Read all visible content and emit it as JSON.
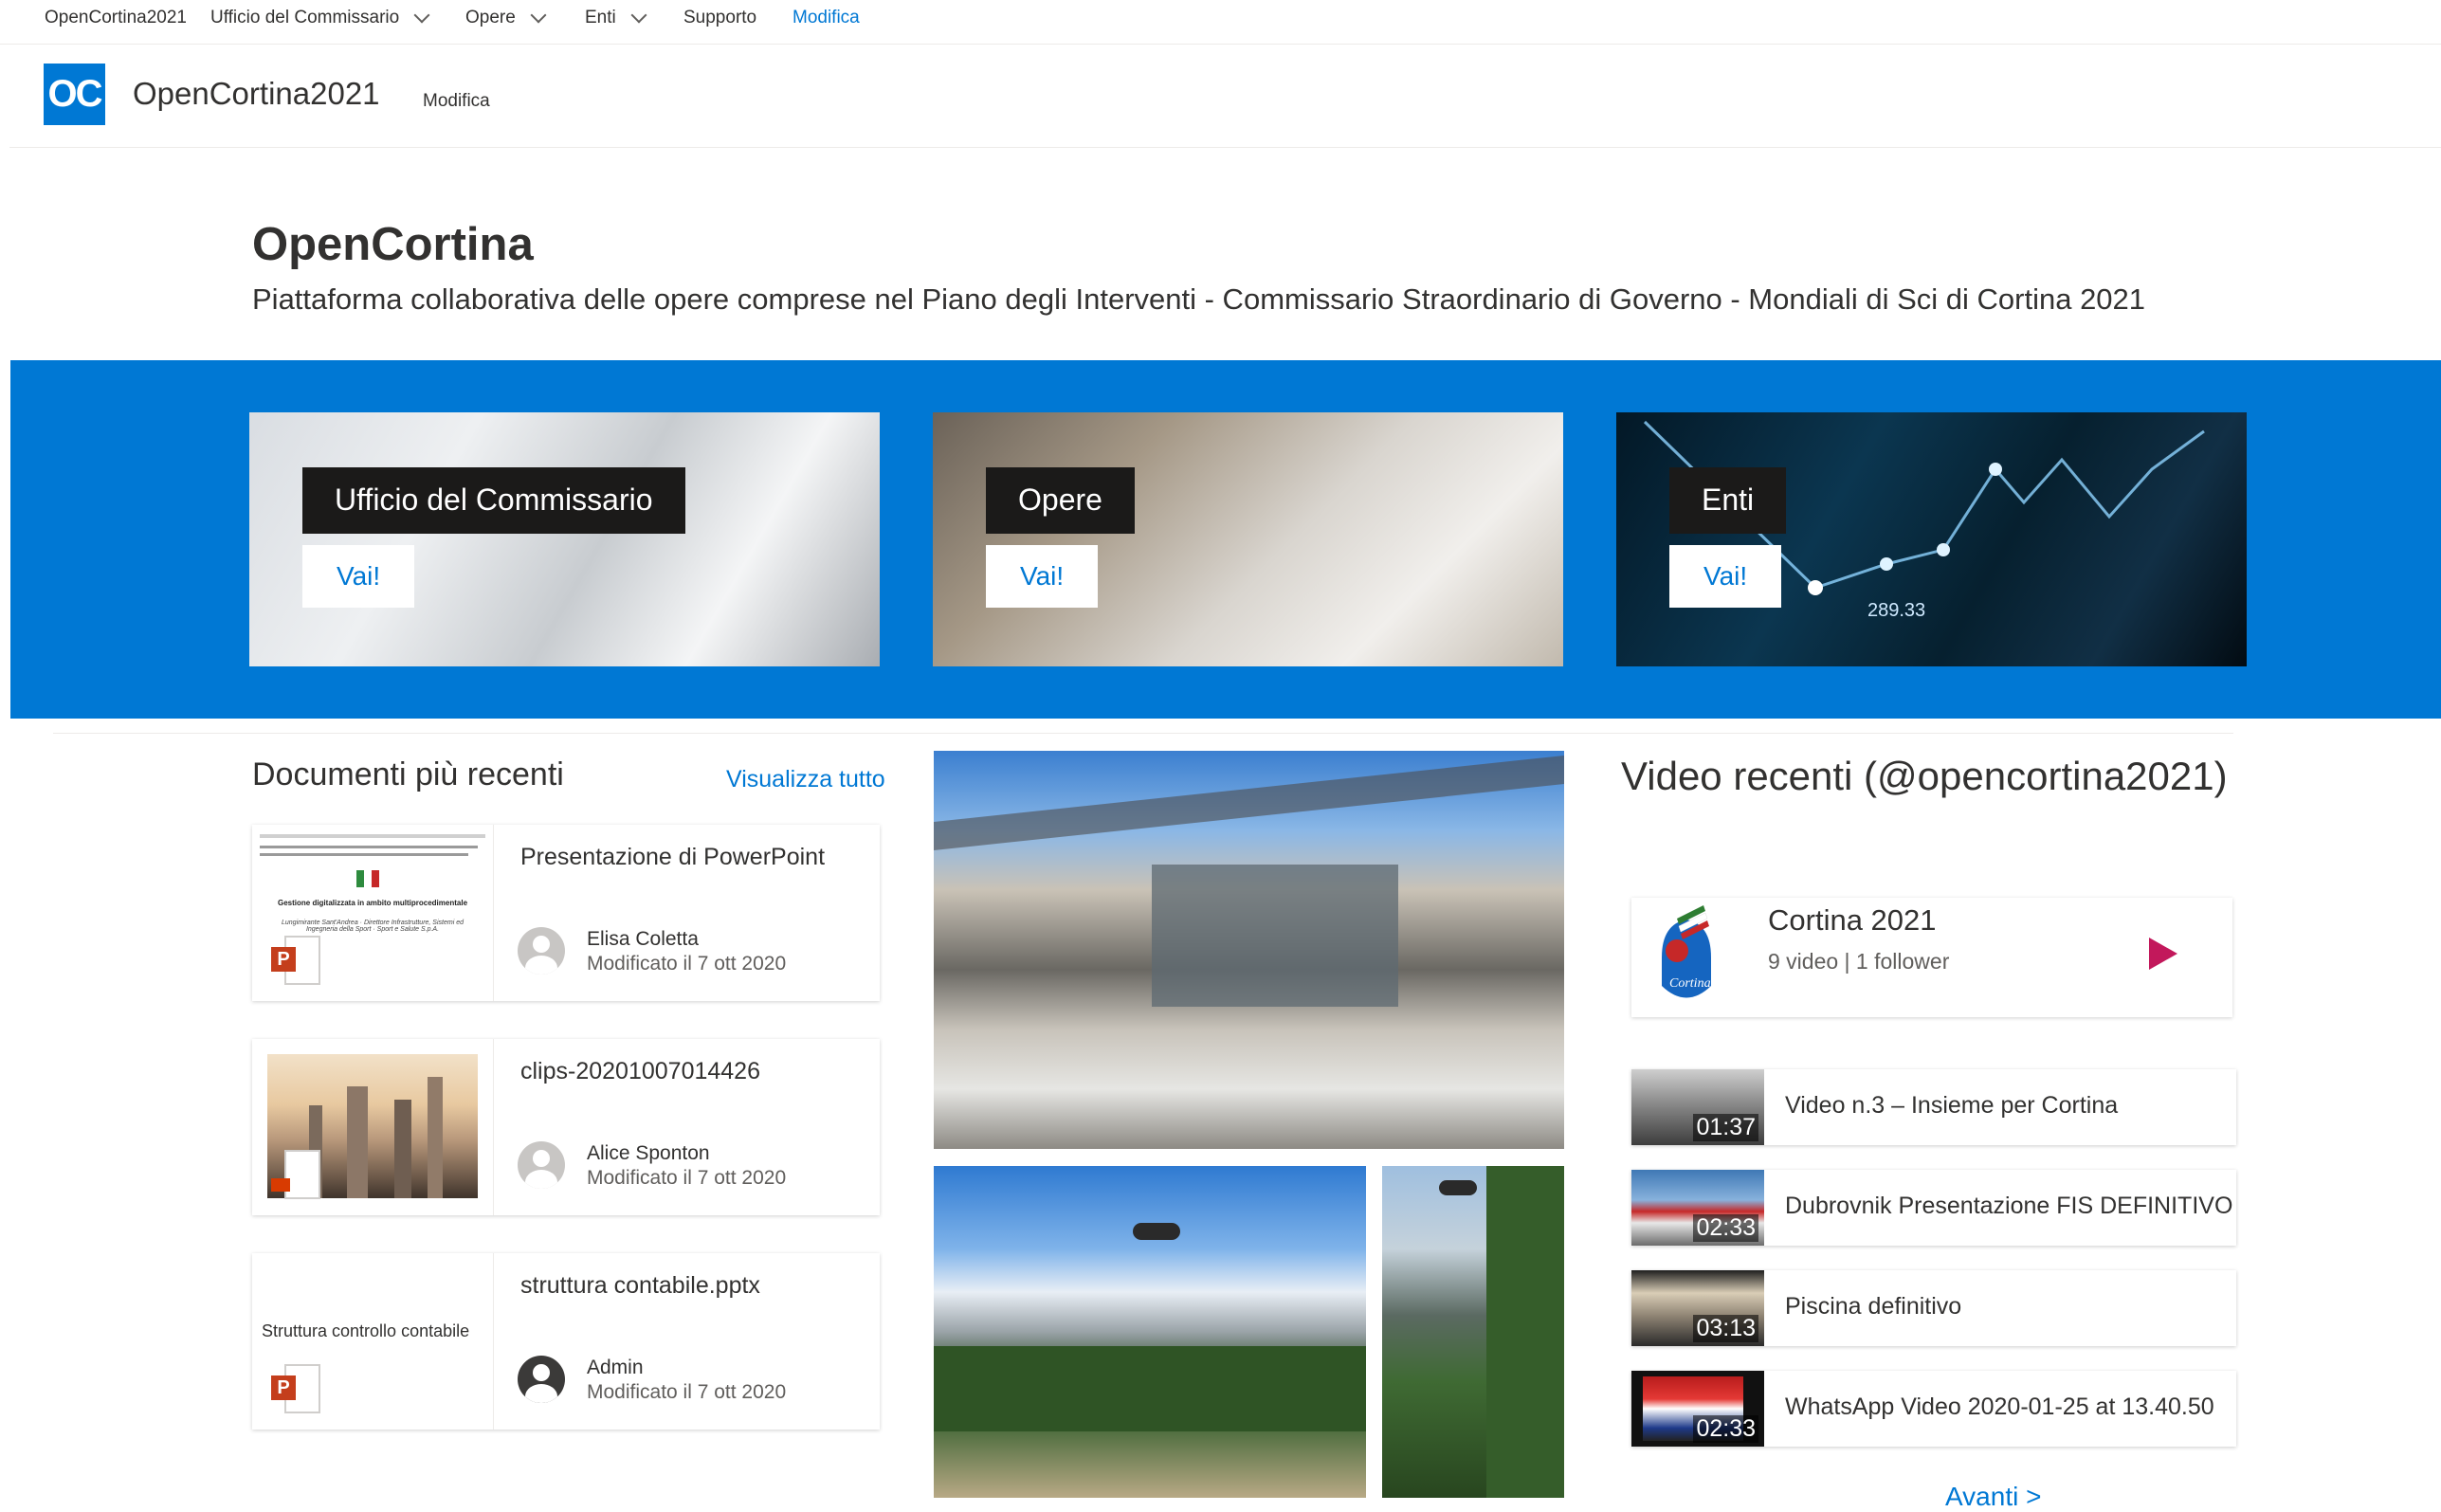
{
  "suite_nav": {
    "items": [
      {
        "label": "OpenCortina2021"
      },
      {
        "label": "Ufficio del Commissario"
      },
      {
        "label": "Opere"
      },
      {
        "label": "Enti"
      },
      {
        "label": "Supporto"
      },
      {
        "label": "Modifica"
      }
    ]
  },
  "site": {
    "logo_text": "OC",
    "title": "OpenCortina2021",
    "edit_label": "Modifica"
  },
  "hero": {
    "title": "OpenCortina",
    "subtitle": "Piattaforma collaborativa delle opere comprese nel Piano degli Interventi - Commissario Straordinario di Governo - Mondiali di Sci di Cortina 2021"
  },
  "tiles": [
    {
      "label": "Ufficio del Commissario",
      "button": "Vai!"
    },
    {
      "label": "Opere",
      "button": "Vai!"
    },
    {
      "label": "Enti",
      "button": "Vai!",
      "chart_value": "289.33"
    }
  ],
  "documents": {
    "title": "Documenti più recenti",
    "view_all": "Visualizza tutto",
    "items": [
      {
        "name": "Presentazione di PowerPoint",
        "author": "Elisa Coletta",
        "modified": "Modificato il 7 ott 2020",
        "thumb_heading": "Gestione digitalizzata in ambito multiprocedimentale",
        "thumb_sub": "Lungimirante Sant'Andrea · Direttore Infrastrutture, Sistemi ed Ingegneria della Sport · Sport e Salute S.p.A."
      },
      {
        "name": "clips-20201007014426",
        "author": "Alice Sponton",
        "modified": "Modificato il 7 ott 2020"
      },
      {
        "name": "struttura contabile.pptx",
        "author": "Admin",
        "modified": "Modificato il 7 ott 2020",
        "thumb_text": "Struttura controllo contabile"
      }
    ]
  },
  "videos": {
    "title": "Video recenti (@opencortina2021)",
    "channel": {
      "name": "Cortina 2021",
      "stats": "9 video | 1 follower",
      "logo_text": "Cortina"
    },
    "items": [
      {
        "title": "Video n.3 – Insieme per Cortina",
        "duration": "01:37"
      },
      {
        "title": "Dubrovnik Presentazione FIS DEFINITIVO",
        "duration": "02:33"
      },
      {
        "title": "Piscina definitivo",
        "duration": "03:13"
      },
      {
        "title": "WhatsApp Video 2020-01-25 at 13.40.50",
        "duration": "02:33"
      }
    ],
    "next_label": "Avanti >"
  },
  "colors": {
    "accent": "#0078d4",
    "text": "#323130",
    "secondary_text": "#605e5c",
    "powerpoint": "#c43e1c",
    "play": "#c2185b"
  }
}
